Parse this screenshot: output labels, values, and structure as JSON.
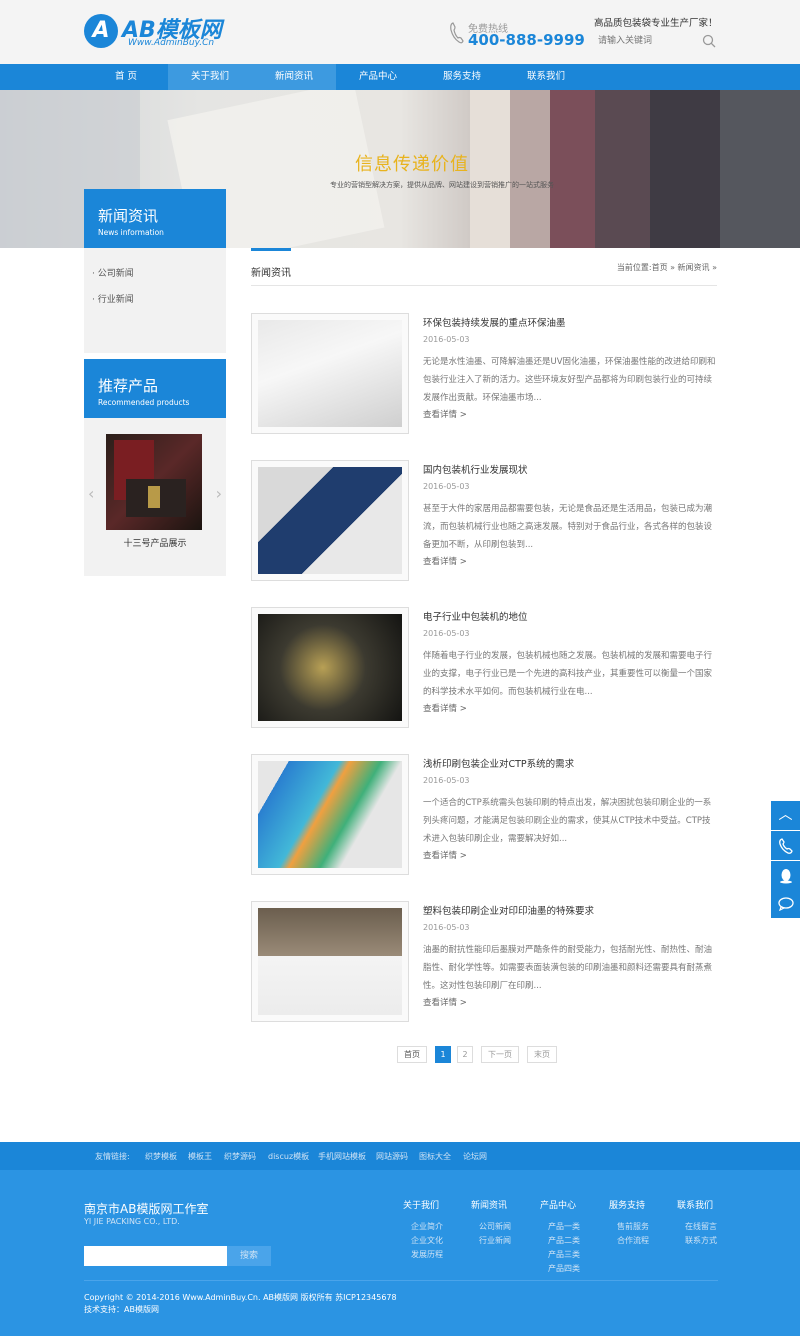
{
  "header": {
    "logo_mark": "A",
    "logo_text": "AB模板网",
    "logo_sub": "Www.AdminBuy.Cn",
    "hotline_label": "免费热线",
    "hotline_number": "400-888-9999",
    "slogan": "高品质包装袋专业生产厂家！",
    "search_placeholder": "请输入关键词"
  },
  "nav": {
    "items": [
      "首 页",
      "关于我们",
      "新闻资讯",
      "产品中心",
      "服务支持",
      "联系我们"
    ]
  },
  "banner": {
    "title": "信息传递价值",
    "subtitle": "专业的营销型解决方案，提供从品牌、网站建设到营销推广的一站式服务"
  },
  "sidebar": {
    "news_cn": "新闻资讯",
    "news_en": "News information",
    "links": [
      "公司新闻",
      "行业新闻"
    ],
    "prod_cn": "推荐产品",
    "prod_en": "Recommended products",
    "prod_caption": "十三号产品展示"
  },
  "crumb": {
    "title": "新闻资讯",
    "path": "当前位置:首页 » 新闻资讯 »"
  },
  "news": [
    {
      "title": "环保包装持续发展的重点环保油墨",
      "date": "2016-05-03",
      "desc": "无论是水性油墨、可降解油墨还是UV固化油墨，环保油墨性能的改进给印刷和包装行业注入了新的活力。这些环境友好型产品都将为印刷包装行业的可持续发展作出贡献。环保油墨市场...",
      "more": "查看详情 >"
    },
    {
      "title": "国内包装机行业发展现状",
      "date": "2016-05-03",
      "desc": "甚至于大件的家居用品都需要包装，无论是食品还是生活用品，包装已成为潮流，而包装机械行业也随之高速发展。特别对于食品行业，各式各样的包装设备更加不断，从印刷包装到...",
      "more": "查看详情 >"
    },
    {
      "title": "电子行业中包装机的地位",
      "date": "2016-05-03",
      "desc": "伴随着电子行业的发展，包装机械也随之发展。包装机械的发展和需要电子行业的支撑，电子行业已是一个先进的高科技产业，其重要性可以衡量一个国家的科学技术水平如何。而包装机械行业在电...",
      "more": "查看详情 >"
    },
    {
      "title": "浅析印刷包装企业对CTP系统的需求",
      "date": "2016-05-03",
      "desc": "一个适合的CTP系统需头包装印刷的特点出发，解决困扰包装印刷企业的一系列头疼问题，才能满足包装印刷企业的需求，使其从CTP技术中受益。CTP技术进入包装印刷企业，需要解决好如...",
      "more": "查看详情 >"
    },
    {
      "title": "塑料包装印刷企业对印印油墨的特殊要求",
      "date": "2016-05-03",
      "desc": "油墨的耐抗性能印后墨膜对严酷条件的耐受能力，包括耐光性、耐热性、耐油脂性、耐化学性等。如需要表面装潢包装的印刷油墨和颜料还需要具有耐蒸煮性。这对性包装印刷厂在印刷...",
      "more": "查看详情 >"
    }
  ],
  "pager": [
    "首页",
    "1",
    "2",
    "下一页",
    "末页"
  ],
  "friends": [
    "友情链接:",
    "织梦模板",
    "模板王",
    "织梦源码",
    "discuz模板",
    "手机网站模板",
    "网站源码",
    "图标大全",
    "论坛网"
  ],
  "footer": {
    "company": "南京市AB模版网工作室",
    "company_en": "YI JIE PACKING CO., LTD.",
    "search_btn": "搜索",
    "cols": [
      {
        "title": "关于我们",
        "links": [
          "企业简介",
          "企业文化",
          "发展历程"
        ]
      },
      {
        "title": "新闻资讯",
        "links": [
          "公司新闻",
          "行业新闻"
        ]
      },
      {
        "title": "产品中心",
        "links": [
          "产品一类",
          "产品二类",
          "产品三类",
          "产品四类"
        ]
      },
      {
        "title": "服务支持",
        "links": [
          "售前服务",
          "合作流程"
        ]
      },
      {
        "title": "联系我们",
        "links": [
          "在线留言",
          "联系方式"
        ]
      }
    ],
    "copyright": "Copyright © 2014-2016 Www.AdminBuy.Cn. AB模版网 版权所有 苏ICP12345678",
    "support": "技术支持：AB模版网"
  },
  "float_icons": [
    "up-arrow-icon",
    "phone-icon",
    "qq-icon",
    "chat-icon"
  ],
  "colors": {
    "primary": "#1b86d8",
    "footer": "#2b94e3",
    "accent": "#e8b31e"
  }
}
